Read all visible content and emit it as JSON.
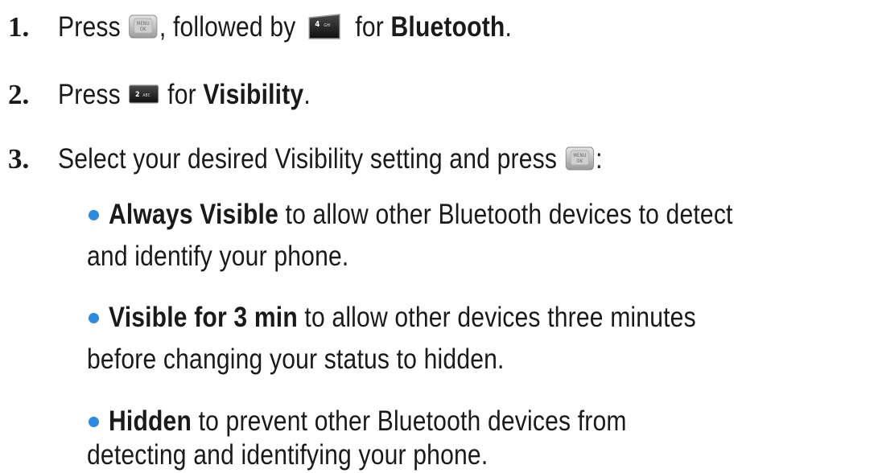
{
  "steps": [
    {
      "number": "1.",
      "press": "Press",
      "followed_by": ", followed by",
      "for": "for",
      "target": "Bluetooth",
      "end": "."
    },
    {
      "number": "2.",
      "press": "Press",
      "for": "for",
      "target": "Visibility",
      "end": "."
    },
    {
      "number": "3.",
      "text": "Select your desired Visibility setting and press",
      "end": ":"
    }
  ],
  "options": [
    {
      "label": "Always Visible",
      "line1": " to allow other Bluetooth devices to detect",
      "line2": "and identify your phone."
    },
    {
      "label": "Visible for 3 min",
      "line1": " to allow other devices three minutes",
      "line2": "before changing your status to hidden."
    },
    {
      "label": "Hidden",
      "line1": " to prevent other Bluetooth devices from",
      "line2": "detecting and identifying your phone."
    }
  ],
  "keys": {
    "menu_ok": {
      "top": "MENU",
      "bottom": "OK",
      "icon": "menu-ok-key-icon"
    },
    "four": {
      "digit": "4",
      "letters": "GHI",
      "icon": "key-4-ghi-icon"
    },
    "two": {
      "digit": "2",
      "letters": "ABC",
      "icon": "key-2-abc-icon"
    }
  },
  "colors": {
    "text": "#1a1a1a",
    "bullet": "#2c8be0"
  }
}
